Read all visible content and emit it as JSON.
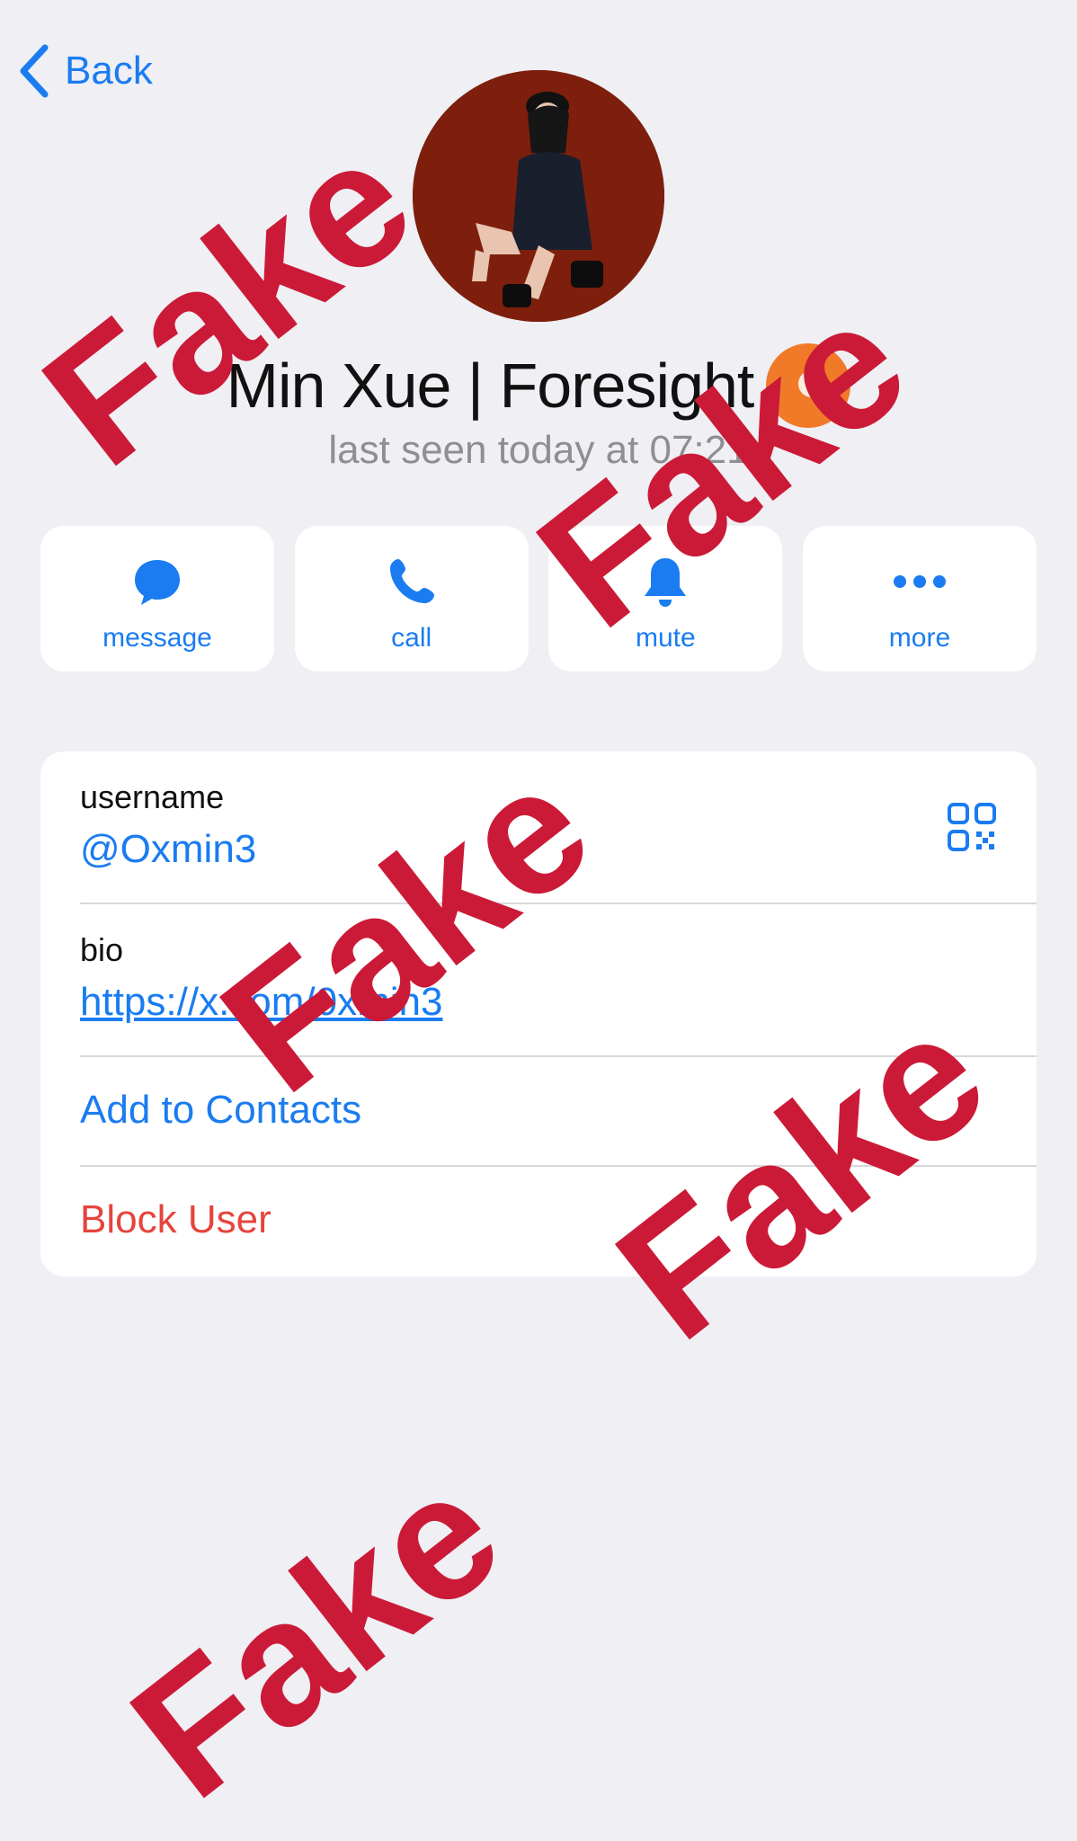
{
  "nav": {
    "back_label": "Back"
  },
  "profile": {
    "name": "Min Xue | Foresight",
    "status": "last seen today at 07:21",
    "badge_icon": "orange-verified-logo-icon",
    "avatar_icon": "profile-photo-woman-on-red"
  },
  "actions": [
    {
      "label": "message",
      "icon": "chat-bubble-icon"
    },
    {
      "label": "call",
      "icon": "phone-icon"
    },
    {
      "label": "mute",
      "icon": "bell-icon"
    },
    {
      "label": "more",
      "icon": "ellipsis-icon"
    }
  ],
  "info": {
    "username_label": "username",
    "username_value": "@Oxmin3",
    "qr_icon": "qr-code-icon",
    "bio_label": "bio",
    "bio_value": "https://x.com/0xmin3",
    "add_contact": "Add to Contacts",
    "block_user": "Block User"
  },
  "watermarks": [
    "Fake",
    "Fake",
    "Fake",
    "Fake",
    "Fake"
  ],
  "colors": {
    "background": "#efeff4",
    "accent": "#1a7cf0",
    "danger": "#e5443c",
    "watermark": "#cb1a37",
    "badge": "#f07a28",
    "avatar_bg": "#7d1f0c"
  }
}
